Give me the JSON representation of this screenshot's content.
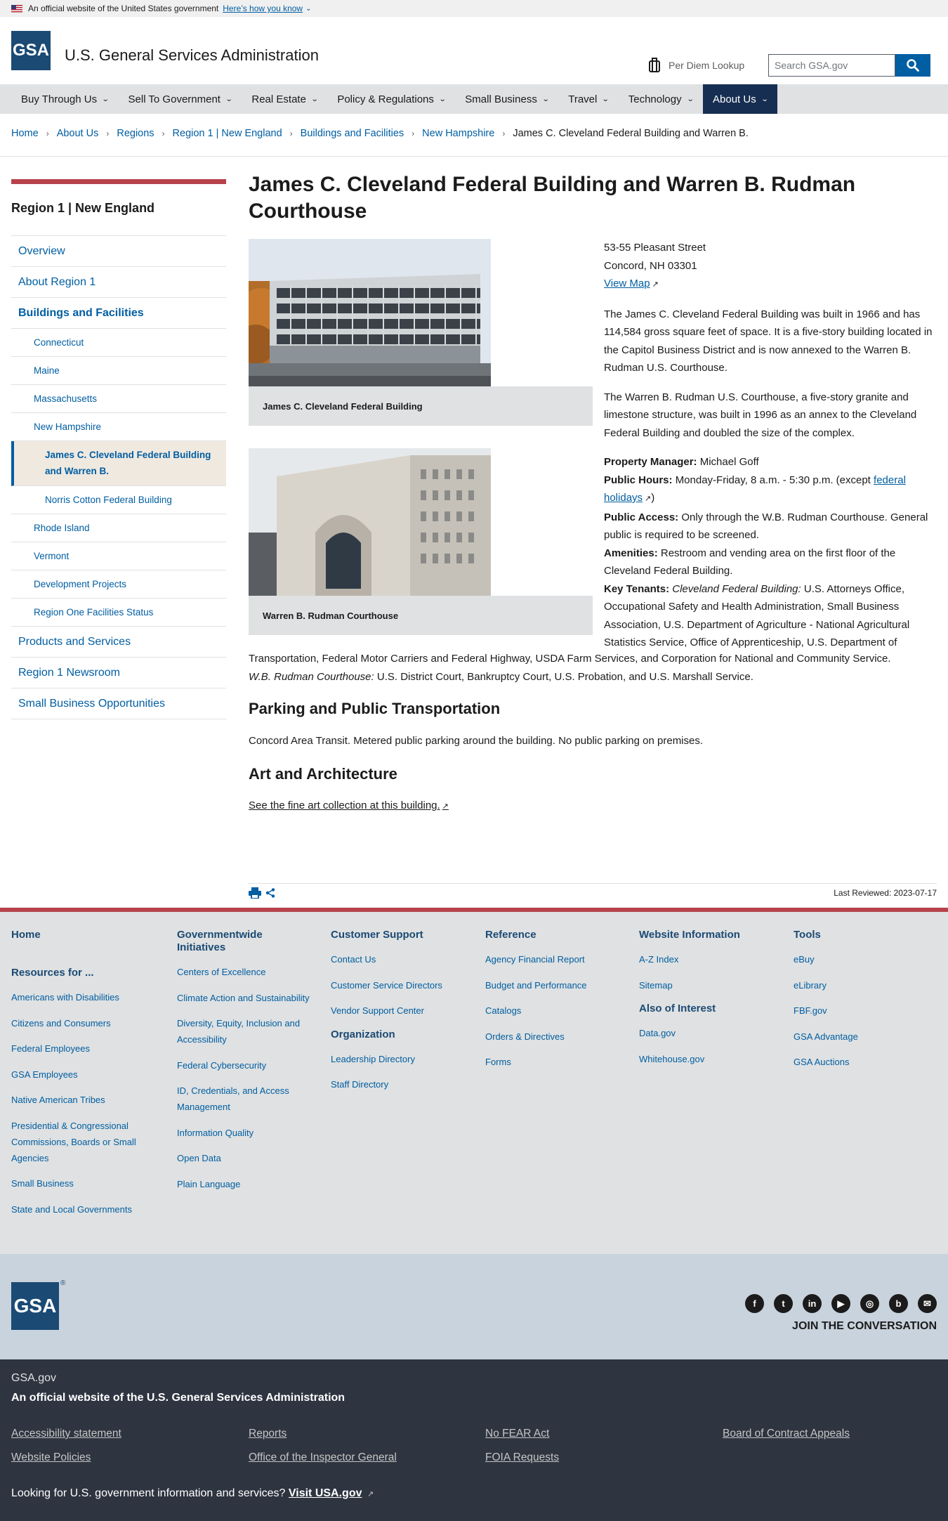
{
  "banner": {
    "text": "An official website of the United States government",
    "link": "Here’s how you know"
  },
  "header": {
    "logo": "GSA",
    "title": "U.S. General Services Administration",
    "per_diem": "Per Diem Lookup",
    "search_placeholder": "Search GSA.gov"
  },
  "nav": [
    "Buy Through Us",
    "Sell To Government",
    "Real Estate",
    "Policy & Regulations",
    "Small Business",
    "Travel",
    "Technology",
    "About Us"
  ],
  "breadcrumb": [
    "Home",
    "About Us",
    "Regions",
    "Region 1 | New England",
    "Buildings and Facilities",
    "New Hampshire",
    "James C. Cleveland Federal Building and Warren B."
  ],
  "sidebar": {
    "title": "Region 1 | New England",
    "items": [
      "Overview",
      "About Region 1",
      "Buildings and Facilities"
    ],
    "states": [
      "Connecticut",
      "Maine",
      "Massachusetts",
      "New Hampshire"
    ],
    "nh_items": [
      "James C. Cleveland Federal Building and Warren B.",
      "Norris Cotton Federal Building"
    ],
    "states2": [
      "Rhode Island",
      "Vermont",
      "Development Projects",
      "Region One Facilities Status"
    ],
    "bottom": [
      "Products and Services",
      "Region 1 Newsroom",
      "Small Business Opportunities"
    ]
  },
  "main": {
    "title": "James C. Cleveland Federal Building and Warren B. Rudman Courthouse",
    "caption1": "James C. Cleveland Federal Building",
    "caption2": "Warren B. Rudman Courthouse",
    "address1": "53-55 Pleasant Street",
    "address2": "Concord, NH 03301",
    "map": "View Map",
    "para1": "The James C. Cleveland Federal Building was built in 1966 and has 114,584 gross square feet of space. It is a five-story building located in the Capitol Business District and is now annexed to the Warren B. Rudman U.S. Courthouse.",
    "para2": "The Warren B. Rudman U.S. Courthouse, a five-story granite and limestone structure, was built in 1996 as an annex to the Cleveland Federal Building and doubled the size of the complex.",
    "pm_label": "Property Manager:",
    "pm": "Michael Goff",
    "hours_label": "Public Hours:",
    "hours": "Monday-Friday, 8 a.m. - 5:30 p.m. (except",
    "hours_link": "federal holidays",
    "hours_end": ")",
    "access_label": "Public Access:",
    "access": "Only through the W.B. Rudman Courthouse. General public is required to be screened.",
    "amen_label": "Amenities:",
    "amen": "Restroom and vending area on the first floor of the Cleveland Federal Building.",
    "tenants_label": "Key Tenants:",
    "tenants_italic": "Cleveland Federal Building:",
    "tenants": "U.S. Attorneys Office, Occupational Safety and Health Administration, Small Business Association, U.S. Department of Agriculture - National Agricultural Statistics Service, Office of Apprenticeship, U.S. Department of",
    "tenants_cont": "Transportation, Federal Motor Carriers and Federal Highway, USDA Farm Services, and Corporation for National and Community Service.",
    "rudman_italic": "W.B. Rudman Courthouse:",
    "rudman": "U.S. District Court, Bankruptcy Court, U.S. Probation, and U.S. Marshall Service.",
    "h_parking": "Parking and Public Transportation",
    "parking": "Concord Area Transit. Metered public parking around the building. No public parking on premises.",
    "h_art": "Art and Architecture",
    "art_link": "See the fine art collection at this building.",
    "last_reviewed": "Last Reviewed: 2023-07-17"
  },
  "footer": {
    "home": "Home",
    "resources_head": "Resources for ...",
    "resources": [
      "Americans with Disabilities",
      "Citizens and Consumers",
      "Federal Employees",
      "GSA Employees",
      "Native American Tribes",
      "Presidential & Congressional Commissions, Boards or Small Agencies",
      "Small Business",
      "State and Local Governments"
    ],
    "gov_head": "Governmentwide Initiatives",
    "gov": [
      "Centers of Excellence",
      "Climate Action and Sustainability",
      "Diversity, Equity, Inclusion and Accessibility",
      "Federal Cybersecurity",
      "ID, Credentials, and Access Management",
      "Information Quality",
      "Open Data",
      "Plain Language"
    ],
    "cs_head": "Customer Support",
    "cs": [
      "Contact Us",
      "Customer Service Directors",
      "Vendor Support Center"
    ],
    "org_head": "Organization",
    "org": [
      "Leadership Directory",
      "Staff Directory"
    ],
    "ref_head": "Reference",
    "ref": [
      "Agency Financial Report",
      "Budget and Performance",
      "Catalogs",
      "Orders & Directives",
      "Forms"
    ],
    "web_head": "Website Information",
    "web": [
      "A-Z Index",
      "Sitemap"
    ],
    "also_head": "Also of Interest",
    "also": [
      "Data.gov",
      "Whitehouse.gov"
    ],
    "tools_head": "Tools",
    "tools": [
      "eBuy",
      "eLibrary",
      "FBF.gov",
      "GSA Advantage",
      "GSA Auctions"
    ],
    "logo": "GSA",
    "join": "JOIN THE CONVERSATION",
    "social": [
      "facebook-icon",
      "twitter-icon",
      "linkedin-icon",
      "youtube-icon",
      "instagram-icon",
      "blog-icon",
      "email-icon"
    ],
    "gsagov": "GSA.gov",
    "official": "An official website of the U.S. General Services Administration",
    "links": [
      "Accessibility statement",
      "Reports",
      "No FEAR Act",
      "Board of Contract Appeals",
      "Website Policies",
      "Office of the Inspector General",
      "FOIA Requests"
    ],
    "looking": "Looking for U.S. government information and services?",
    "usa": "Visit USA.gov"
  }
}
